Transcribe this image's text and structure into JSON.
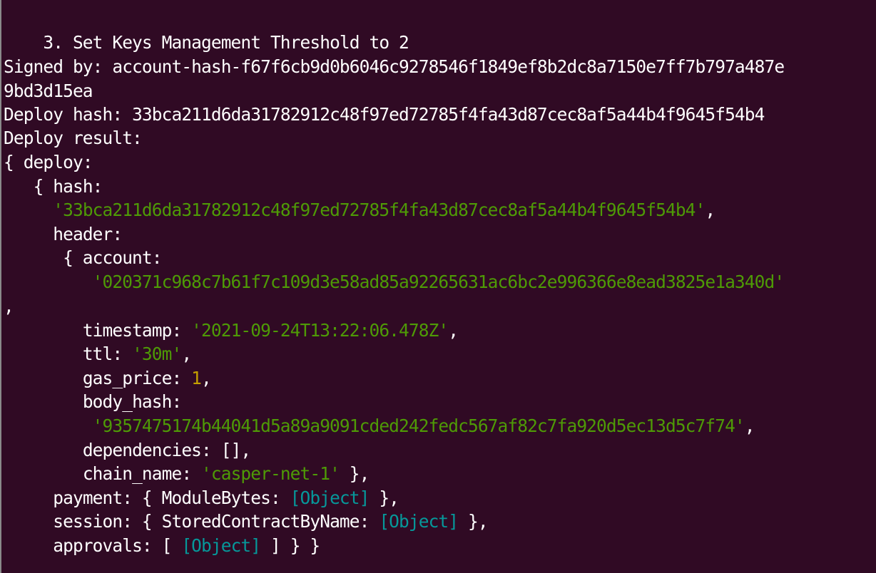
{
  "terminal": {
    "title_line": "3. Set Keys Management Threshold to 2",
    "signed_by_label": "Signed by: ",
    "signed_by_part1": "account-hash-f67f6cb9d0b6046c9278546f1849ef8b2dc8a7150e7ff7b797a487e",
    "signed_by_part2": "9bd3d15ea",
    "deploy_hash_label": "Deploy hash: ",
    "deploy_hash_value": "33bca211d6da31782912c48f97ed72785f4fa43d87cec8af5a44b4f9645f54b4",
    "deploy_result_label": "Deploy result:",
    "deploy_open": "{ deploy:",
    "hash_key": "{ hash:",
    "hash_value": "'33bca211d6da31782912c48f97ed72785f4fa43d87cec8af5a44b4f9645f54b4'",
    "header_key": "header:",
    "account_key": "{ account:",
    "account_value": "'020371c968c7b61f7c109d3e58ad85a92265631ac6bc2e996366e8ead3825e1a340d'",
    "lone_comma": ",",
    "timestamp_key": "timestamp: ",
    "timestamp_value": "'2021-09-24T13:22:06.478Z'",
    "ttl_key": "ttl: ",
    "ttl_value": "'30m'",
    "gas_price_key": "gas_price: ",
    "gas_price_value": "1",
    "body_hash_key": "body_hash:",
    "body_hash_value": "'9357475174b44041d5a89a9091cded242fedc567af82c7fa920d5ec13d5c7f74'",
    "dependencies_line": "dependencies: [],",
    "chain_name_key": "chain_name: ",
    "chain_name_value": "'casper-net-1'",
    "chain_name_close": " },",
    "payment_key": "payment: { ModuleBytes: ",
    "payment_obj": "[Object]",
    "payment_close": " },",
    "session_key": "session: { StoredContractByName: ",
    "session_obj": "[Object]",
    "session_close": " },",
    "approvals_key": "approvals: [ ",
    "approvals_obj": "[Object]",
    "approvals_close": " ] } }"
  },
  "colors": {
    "background": "#300a24",
    "string": "#4e9a06",
    "number": "#c4a000",
    "object": "#06989a",
    "text": "#ffffff"
  }
}
